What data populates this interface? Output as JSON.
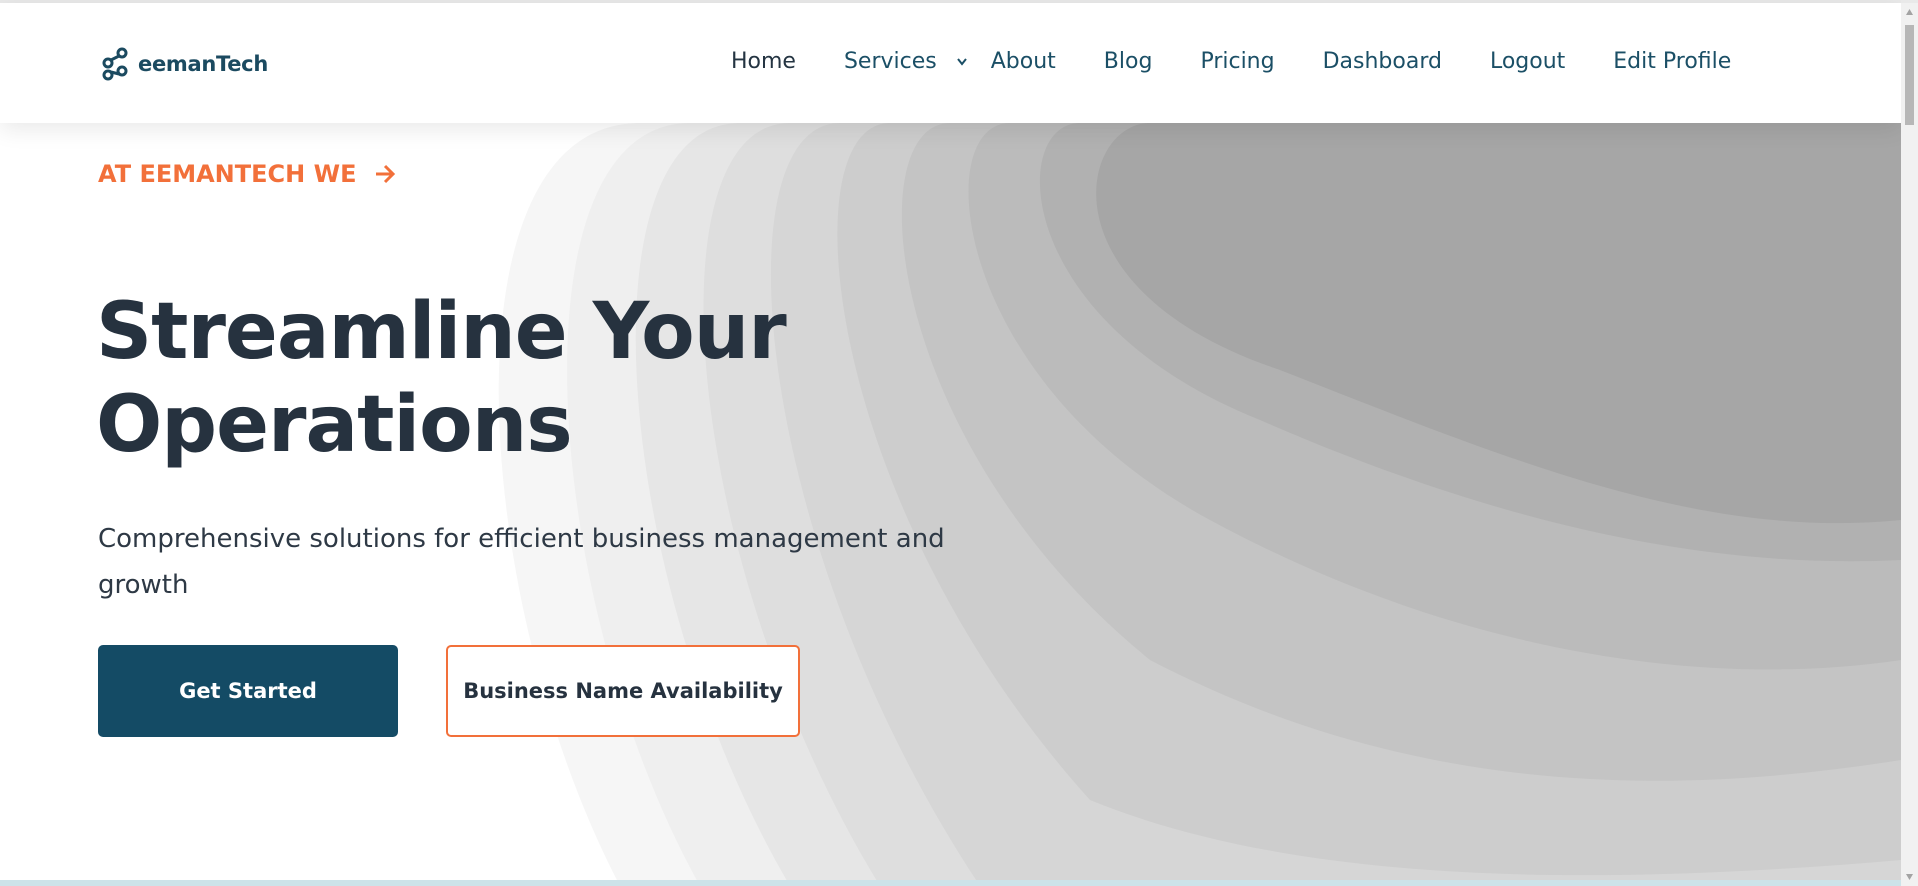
{
  "brand": {
    "name": "eemanTech",
    "icon": "link-nodes-icon"
  },
  "nav": {
    "items": [
      {
        "label": "Home"
      },
      {
        "label": "Services",
        "icon": "chevron-down-icon"
      },
      {
        "label": "About"
      },
      {
        "label": "Blog"
      },
      {
        "label": "Pricing"
      },
      {
        "label": "Dashboard"
      },
      {
        "label": "Logout"
      },
      {
        "label": "Edit Profile"
      }
    ]
  },
  "hero": {
    "eyebrow": "AT EEMANTECH WE",
    "eyebrow_icon": "arrow-right-icon",
    "title_line1": "Streamline Your",
    "title_line2": "Operations",
    "subtitle": "Comprehensive solutions for efficient business management and growth",
    "primary_button": "Get Started",
    "secondary_button": "Business Name Availability"
  },
  "colors": {
    "brand_navy": "#144b65",
    "accent_orange": "#f2703a",
    "heading": "#26323f"
  }
}
